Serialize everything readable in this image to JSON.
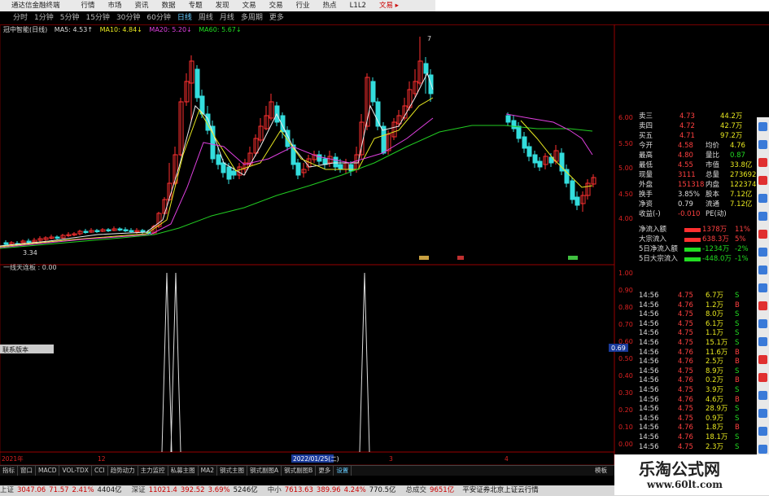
{
  "titlebar": {
    "app_name": "通达信金融终端",
    "menus": [
      "行情",
      "市场",
      "资讯",
      "数据",
      "专题",
      "发现",
      "文易",
      "交易",
      "行业",
      "热点",
      "L1L2"
    ],
    "right_label": "文易 ▸"
  },
  "periods": {
    "items": [
      "分时",
      "1分钟",
      "5分钟",
      "15分钟",
      "30分钟",
      "60分钟",
      "日线",
      "周线",
      "月线",
      "多周期",
      "更多"
    ],
    "active": "日线"
  },
  "ma_line": {
    "stock": "冠中智能(日线)",
    "ma5": "MA5: 4.53↑",
    "ma10": "MA10: 4.84↓",
    "ma20": "MA20: 5.20↓",
    "ma60": "MA60: 5.67↓"
  },
  "price_axis": [
    "6.00",
    "5.50",
    "5.00",
    "4.50",
    "4.00"
  ],
  "price_labels": {
    "high_marker": "7",
    "low_marker": "3.34"
  },
  "indicator": {
    "title": "一线天连板 : 0.00",
    "axis": [
      "1.00",
      "0.90",
      "0.80",
      "0.70",
      "0.60",
      "0.50",
      "0.40",
      "0.30",
      "0.20",
      "0.10",
      "0.00"
    ],
    "cursor_value": "0.69"
  },
  "floating_label": "联系版本",
  "date_axis": {
    "labels": [
      "2021年",
      "12",
      "2022/01/25(二)",
      "3",
      "4"
    ]
  },
  "quote": {
    "order_rows": [
      {
        "label": "卖三",
        "price": "4.73",
        "vol": "44.2万"
      },
      {
        "label": "卖四",
        "price": "4.72",
        "vol": "42.7万"
      },
      {
        "label": "买五",
        "price": "4.71",
        "vol": "97.2万"
      }
    ],
    "stats": [
      {
        "l1": "今开",
        "v1": "4.58",
        "l2": "均价",
        "v2": "4.76"
      },
      {
        "l1": "最高",
        "v1": "4.80",
        "l2": "量比",
        "v2": "0.87"
      },
      {
        "l1": "最低",
        "v1": "4.55",
        "l2": "市值",
        "v2": "33.8亿"
      },
      {
        "l1": "现量",
        "v1": "3111",
        "l2": "总量",
        "v2": "273692"
      },
      {
        "l1": "外盘",
        "v1": "151318",
        "l2": "内盘",
        "v2": "122374"
      },
      {
        "l1": "换手",
        "v1": "3.85%",
        "l2": "股本",
        "v2": "7.12亿"
      },
      {
        "l1": "净资",
        "v1": "0.79",
        "l2": "流通",
        "v2": "7.12亿"
      },
      {
        "l1": "收益(-)",
        "v1": "-0.010",
        "l2": "PE(动)",
        "v2": ""
      }
    ],
    "flows": [
      {
        "label": "净流入额",
        "value": "1378万",
        "pct": "11%"
      },
      {
        "label": "大宗流入",
        "value": "638.3万",
        "pct": "5%"
      },
      {
        "label": "5日净流入额",
        "value": "-1234万",
        "pct": "-2%"
      },
      {
        "label": "5日大宗流入",
        "value": "-448.0万",
        "pct": "-1%"
      }
    ]
  },
  "ticks": [
    {
      "t": "14:56",
      "p": "4.75",
      "v": "6.7万",
      "d": "S"
    },
    {
      "t": "14:56",
      "p": "4.76",
      "v": "1.2万",
      "d": "B"
    },
    {
      "t": "14:56",
      "p": "4.75",
      "v": "8.0万",
      "d": "S"
    },
    {
      "t": "14:56",
      "p": "4.75",
      "v": "6.1万",
      "d": "S"
    },
    {
      "t": "14:56",
      "p": "4.75",
      "v": "1.1万",
      "d": "S"
    },
    {
      "t": "14:56",
      "p": "4.75",
      "v": "15.1万",
      "d": "S"
    },
    {
      "t": "14:56",
      "p": "4.76",
      "v": "11.6万",
      "d": "B"
    },
    {
      "t": "14:56",
      "p": "4.76",
      "v": "2.5万",
      "d": "B"
    },
    {
      "t": "14:56",
      "p": "4.75",
      "v": "8.9万",
      "d": "S"
    },
    {
      "t": "14:56",
      "p": "4.76",
      "v": "0.2万",
      "d": "B"
    },
    {
      "t": "14:56",
      "p": "4.75",
      "v": "3.9万",
      "d": "S"
    },
    {
      "t": "14:56",
      "p": "4.76",
      "v": "4.6万",
      "d": "B"
    },
    {
      "t": "14:56",
      "p": "4.75",
      "v": "28.9万",
      "d": "S"
    },
    {
      "t": "14:56",
      "p": "4.75",
      "v": "0.9万",
      "d": "S"
    },
    {
      "t": "14:56",
      "p": "4.76",
      "v": "1.8万",
      "d": "B"
    },
    {
      "t": "14:56",
      "p": "4.76",
      "v": "18.1万",
      "d": "S"
    },
    {
      "t": "14:56",
      "p": "4.75",
      "v": "2.3万",
      "d": "S"
    }
  ],
  "tabs": [
    "指标",
    "窗口",
    "MACD",
    "VOL-TDX",
    "CCI",
    "趋势动力",
    "主力监控",
    "私募主图",
    "MA2",
    "钢式主图",
    "钢式副图A",
    "钢式副图B",
    "更多",
    "设置"
  ],
  "tabs_right": "模板",
  "statusbar": [
    {
      "label": "上证",
      "v": "3047.06",
      "c": "71.57",
      "p": "2.41%",
      "a": "4404亿"
    },
    {
      "label": "深证",
      "v": "11021.4",
      "c": "392.52",
      "p": "3.69%",
      "a": "5246亿"
    },
    {
      "label": "中小",
      "v": "7613.63",
      "c": "389.96",
      "p": "4.24%",
      "a": "770.5亿"
    },
    {
      "label": "总成交",
      "v": "9651亿",
      "c": "",
      "p": "",
      "a": ""
    }
  ],
  "status_tail": "平安证券北京上证云行情",
  "watermark": {
    "title": "乐淘公式网",
    "url": "www.60lt.com"
  }
}
